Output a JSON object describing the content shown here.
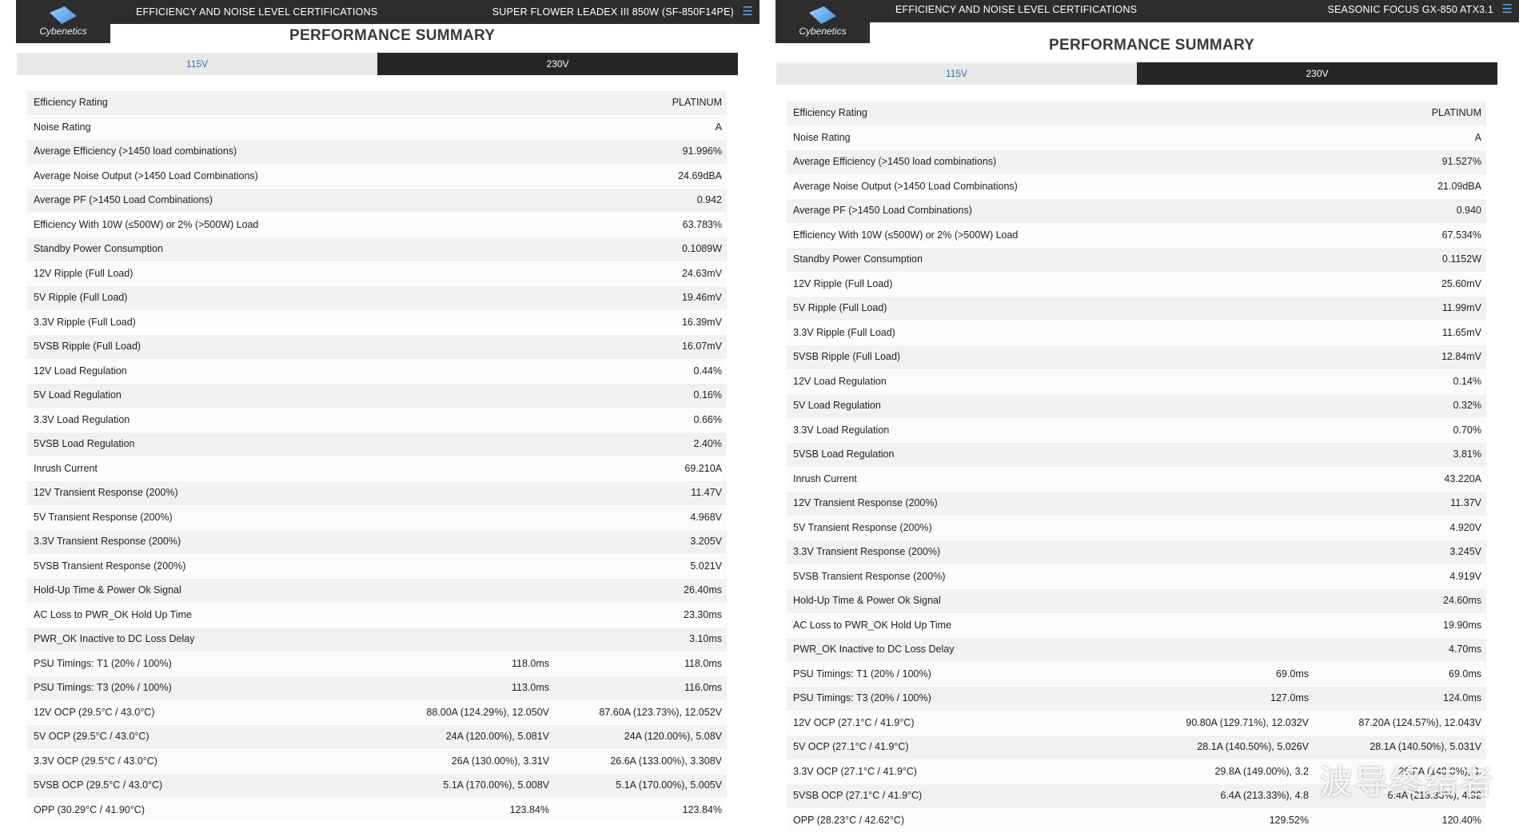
{
  "left": {
    "header_title": "EFFICIENCY AND NOISE LEVEL CERTIFICATIONS",
    "product": "SUPER FLOWER LEADEX III 850W (SF-850F14PE)",
    "logo_text": "Cybenetics",
    "section_title": "PERFORMANCE SUMMARY",
    "tab_115": "115V",
    "tab_230": "230V",
    "rows": [
      {
        "label": "Efficiency Rating",
        "value": "PLATINUM"
      },
      {
        "label": "Noise Rating",
        "value": "A"
      },
      {
        "label": "Average Efficiency (>1450 load combinations)",
        "value": "91.996%"
      },
      {
        "label": "Average Noise Output (>1450 Load Combinations)",
        "value": "24.69dBA"
      },
      {
        "label": "Average PF (>1450 Load Combinations)",
        "value": "0.942"
      },
      {
        "label": "Efficiency With 10W (≤500W) or 2% (>500W) Load",
        "value": "63.783%"
      },
      {
        "label": "Standby Power Consumption",
        "value": "0.1089W"
      },
      {
        "label": "12V Ripple (Full Load)",
        "value": "24.63mV"
      },
      {
        "label": "5V Ripple (Full Load)",
        "value": "19.46mV"
      },
      {
        "label": "3.3V Ripple (Full Load)",
        "value": "16.39mV"
      },
      {
        "label": "5VSB Ripple (Full Load)",
        "value": "16.07mV"
      },
      {
        "label": "12V Load Regulation",
        "value": "0.44%"
      },
      {
        "label": "5V Load Regulation",
        "value": "0.16%"
      },
      {
        "label": "3.3V Load Regulation",
        "value": "0.66%"
      },
      {
        "label": "5VSB Load Regulation",
        "value": "2.40%"
      },
      {
        "label": "Inrush Current",
        "value": "69.210A"
      },
      {
        "label": "12V Transient Response (200%)",
        "value": "11.47V"
      },
      {
        "label": "5V Transient Response (200%)",
        "value": "4.968V"
      },
      {
        "label": "3.3V Transient Response (200%)",
        "value": "3.205V"
      },
      {
        "label": "5VSB Transient Response (200%)",
        "value": "5.021V"
      },
      {
        "label": "Hold-Up Time & Power Ok Signal",
        "value": "26.40ms"
      },
      {
        "label": "AC Loss to PWR_OK Hold Up Time",
        "value": "23.30ms"
      },
      {
        "label": "PWR_OK Inactive to DC Loss Delay",
        "value": "3.10ms"
      },
      {
        "label": "PSU Timings: T1 (20% / 100%)",
        "mid": "118.0ms",
        "value": "118.0ms"
      },
      {
        "label": "PSU Timings: T3 (20% / 100%)",
        "mid": "113.0ms",
        "value": "116.0ms"
      },
      {
        "label": "12V OCP (29.5°C / 43.0°C)",
        "mid": "88.00A (124.29%), 12.050V",
        "value": "87.60A (123.73%), 12.052V"
      },
      {
        "label": "5V OCP (29.5°C / 43.0°C)",
        "mid": "24A (120.00%), 5.081V",
        "value": "24A (120.00%), 5.08V"
      },
      {
        "label": "3.3V OCP (29.5°C / 43.0°C)",
        "mid": "26A (130.00%), 3.31V",
        "value": "26.6A (133.00%), 3.308V"
      },
      {
        "label": "5VSB OCP (29.5°C / 43.0°C)",
        "mid": "5.1A (170.00%), 5.008V",
        "value": "5.1A (170.00%), 5.005V"
      },
      {
        "label": "OPP (30.29°C / 41.90°C)",
        "mid": "123.84%",
        "value": "123.84%"
      }
    ]
  },
  "right": {
    "header_title": "EFFICIENCY AND NOISE LEVEL CERTIFICATIONS",
    "product": "SEASONIC FOCUS GX-850 ATX3.1",
    "logo_text": "Cybenetics",
    "section_title": "PERFORMANCE SUMMARY",
    "tab_115": "115V",
    "tab_230": "230V",
    "rows": [
      {
        "label": "Efficiency Rating",
        "value": "PLATINUM"
      },
      {
        "label": "Noise Rating",
        "value": "A"
      },
      {
        "label": "Average Efficiency (>1450 load combinations)",
        "value": "91.527%"
      },
      {
        "label": "Average Noise Output (>1450 Load Combinations)",
        "value": "21.09dBA"
      },
      {
        "label": "Average PF (>1450 Load Combinations)",
        "value": "0.940"
      },
      {
        "label": "Efficiency With 10W (≤500W) or 2% (>500W) Load",
        "value": "67.534%"
      },
      {
        "label": "Standby Power Consumption",
        "value": "0.1152W"
      },
      {
        "label": "12V Ripple (Full Load)",
        "value": "25.60mV"
      },
      {
        "label": "5V Ripple (Full Load)",
        "value": "11.99mV"
      },
      {
        "label": "3.3V Ripple (Full Load)",
        "value": "11.65mV"
      },
      {
        "label": "5VSB Ripple (Full Load)",
        "value": "12.84mV"
      },
      {
        "label": "12V Load Regulation",
        "value": "0.14%"
      },
      {
        "label": "5V Load Regulation",
        "value": "0.32%"
      },
      {
        "label": "3.3V Load Regulation",
        "value": "0.70%"
      },
      {
        "label": "5VSB Load Regulation",
        "value": "3.81%"
      },
      {
        "label": "Inrush Current",
        "value": "43.220A"
      },
      {
        "label": "12V Transient Response (200%)",
        "value": "11.37V"
      },
      {
        "label": "5V Transient Response (200%)",
        "value": "4.920V"
      },
      {
        "label": "3.3V Transient Response (200%)",
        "value": "3.245V"
      },
      {
        "label": "5VSB Transient Response (200%)",
        "value": "4.919V"
      },
      {
        "label": "Hold-Up Time & Power Ok Signal",
        "value": "24.60ms"
      },
      {
        "label": "AC Loss to PWR_OK Hold Up Time",
        "value": "19.90ms"
      },
      {
        "label": "PWR_OK Inactive to DC Loss Delay",
        "value": "4.70ms"
      },
      {
        "label": "PSU Timings: T1 (20% / 100%)",
        "mid": "69.0ms",
        "value": "69.0ms"
      },
      {
        "label": "PSU Timings: T3 (20% / 100%)",
        "mid": "127.0ms",
        "value": "124.0ms"
      },
      {
        "label": "12V OCP (27.1°C / 41.9°C)",
        "mid": "90.80A (129.71%), 12.032V",
        "value": "87.20A (124.57%), 12.043V"
      },
      {
        "label": "5V OCP (27.1°C / 41.9°C)",
        "mid": "28.1A (140.50%), 5.026V",
        "value": "28.1A (140.50%), 5.031V"
      },
      {
        "label": "3.3V OCP (27.1°C / 41.9°C)",
        "mid": "29.8A (149.00%), 3.2",
        "value": "29.8A (149.0%), 3."
      },
      {
        "label": "5VSB OCP (27.1°C / 41.9°C)",
        "mid": "6.4A (213.33%), 4.8",
        "value": "6.4A (213.33%), 4.92"
      },
      {
        "label": "OPP (28.23°C / 42.62°C)",
        "mid": "129.52%",
        "value": "120.40%"
      }
    ]
  },
  "watermark": "波导终结者"
}
